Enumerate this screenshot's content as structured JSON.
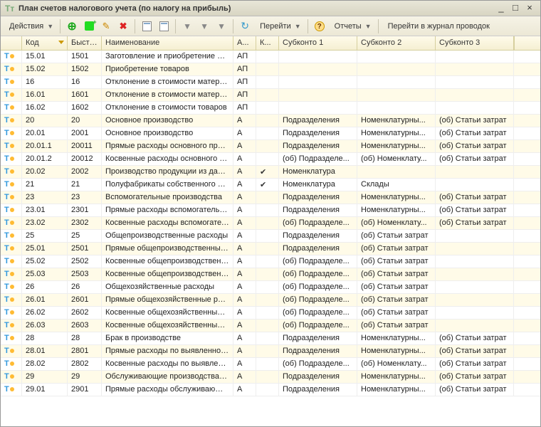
{
  "title": "План счетов налогового учета (по налогу на прибыль)",
  "toolbar": {
    "actions": "Действия",
    "go": "Перейти",
    "reports": "Отчеты",
    "journal": "Перейти в журнал проводок"
  },
  "columns": [
    "",
    "Код",
    "Быстр...",
    "Наименование",
    "А...",
    "К...",
    "Субконто 1",
    "Субконто 2",
    "Субконто 3"
  ],
  "rows": [
    {
      "code": "15.01",
      "fast": "1501",
      "name": "Заготовление и приобретение ма...",
      "ap": "АП",
      "k": "",
      "s1": "",
      "s2": "",
      "s3": ""
    },
    {
      "code": "15.02",
      "fast": "1502",
      "name": "Приобретение товаров",
      "ap": "АП",
      "k": "",
      "s1": "",
      "s2": "",
      "s3": ""
    },
    {
      "code": "16",
      "fast": "16",
      "name": "Отклонение в стоимости материа...",
      "ap": "АП",
      "k": "",
      "s1": "",
      "s2": "",
      "s3": ""
    },
    {
      "code": "16.01",
      "fast": "1601",
      "name": "Отклонение в стоимости материа...",
      "ap": "АП",
      "k": "",
      "s1": "",
      "s2": "",
      "s3": ""
    },
    {
      "code": "16.02",
      "fast": "1602",
      "name": "Отклонение в стоимости товаров",
      "ap": "АП",
      "k": "",
      "s1": "",
      "s2": "",
      "s3": ""
    },
    {
      "code": "20",
      "fast": "20",
      "name": "Основное производство",
      "ap": "А",
      "k": "",
      "s1": "Подразделения",
      "s2": "Номенклатурны...",
      "s3": "(об) Статьи затрат"
    },
    {
      "code": "20.01",
      "fast": "2001",
      "name": "Основное производство",
      "ap": "А",
      "k": "",
      "s1": "Подразделения",
      "s2": "Номенклатурны...",
      "s3": "(об) Статьи затрат"
    },
    {
      "code": "20.01.1",
      "fast": "20011",
      "name": "Прямые расходы основного прои...",
      "ap": "А",
      "k": "",
      "s1": "Подразделения",
      "s2": "Номенклатурны...",
      "s3": "(об) Статьи затрат"
    },
    {
      "code": "20.01.2",
      "fast": "20012",
      "name": "Косвенные расходы основного пр...",
      "ap": "А",
      "k": "",
      "s1": "(об) Подразделе...",
      "s2": "(об) Номенклату...",
      "s3": "(об) Статьи затрат"
    },
    {
      "code": "20.02",
      "fast": "2002",
      "name": "Производство продукции из дава...",
      "ap": "А",
      "k": "✔",
      "s1": "Номенклатура",
      "s2": "",
      "s3": ""
    },
    {
      "code": "21",
      "fast": "21",
      "name": "Полуфабрикаты собственного пр...",
      "ap": "А",
      "k": "✔",
      "s1": "Номенклатура",
      "s2": "Склады",
      "s3": ""
    },
    {
      "code": "23",
      "fast": "23",
      "name": "Вспомогательные производства",
      "ap": "А",
      "k": "",
      "s1": "Подразделения",
      "s2": "Номенклатурны...",
      "s3": "(об) Статьи затрат"
    },
    {
      "code": "23.01",
      "fast": "2301",
      "name": "Прямые расходы вспомогательн...",
      "ap": "А",
      "k": "",
      "s1": "Подразделения",
      "s2": "Номенклатурны...",
      "s3": "(об) Статьи затрат"
    },
    {
      "code": "23.02",
      "fast": "2302",
      "name": "Косвенные расходы вспомогател...",
      "ap": "А",
      "k": "",
      "s1": "(об) Подразделе...",
      "s2": "(об) Номенклату...",
      "s3": "(об) Статьи затрат"
    },
    {
      "code": "25",
      "fast": "25",
      "name": "Общепроизводственные расходы",
      "ap": "А",
      "k": "",
      "s1": "Подразделения",
      "s2": "(об) Статьи затрат",
      "s3": ""
    },
    {
      "code": "25.01",
      "fast": "2501",
      "name": "Прямые общепроизводственные ...",
      "ap": "А",
      "k": "",
      "s1": "Подразделения",
      "s2": "(об) Статьи затрат",
      "s3": ""
    },
    {
      "code": "25.02",
      "fast": "2502",
      "name": "Косвенные общепроизводственн...",
      "ap": "А",
      "k": "",
      "s1": "(об) Подразделе...",
      "s2": "(об) Статьи затрат",
      "s3": ""
    },
    {
      "code": "25.03",
      "fast": "2503",
      "name": "Косвенные общепроизводственн...",
      "ap": "А",
      "k": "",
      "s1": "(об) Подразделе...",
      "s2": "(об) Статьи затрат",
      "s3": ""
    },
    {
      "code": "26",
      "fast": "26",
      "name": "Общехозяйственные расходы",
      "ap": "А",
      "k": "",
      "s1": "(об) Подразделе...",
      "s2": "(об) Статьи затрат",
      "s3": ""
    },
    {
      "code": "26.01",
      "fast": "2601",
      "name": "Прямые общехозяйственные рас...",
      "ap": "А",
      "k": "",
      "s1": "(об) Подразделе...",
      "s2": "(об) Статьи затрат",
      "s3": ""
    },
    {
      "code": "26.02",
      "fast": "2602",
      "name": "Косвенные общехозяйственные р...",
      "ap": "А",
      "k": "",
      "s1": "(об) Подразделе...",
      "s2": "(об) Статьи затрат",
      "s3": ""
    },
    {
      "code": "26.03",
      "fast": "2603",
      "name": "Косвенные общехозяйственные р...",
      "ap": "А",
      "k": "",
      "s1": "(об) Подразделе...",
      "s2": "(об) Статьи затрат",
      "s3": ""
    },
    {
      "code": "28",
      "fast": "28",
      "name": "Брак в производстве",
      "ap": "А",
      "k": "",
      "s1": "Подразделения",
      "s2": "Номенклатурны...",
      "s3": "(об) Статьи затрат"
    },
    {
      "code": "28.01",
      "fast": "2801",
      "name": "Прямые расходы по выявленном...",
      "ap": "А",
      "k": "",
      "s1": "Подразделения",
      "s2": "Номенклатурны...",
      "s3": "(об) Статьи затрат"
    },
    {
      "code": "28.02",
      "fast": "2802",
      "name": "Косвенные расходы по выявленн...",
      "ap": "А",
      "k": "",
      "s1": "(об) Подразделе...",
      "s2": "(об) Номенклату...",
      "s3": "(об) Статьи затрат"
    },
    {
      "code": "29",
      "fast": "29",
      "name": "Обслуживающие производства и ...",
      "ap": "А",
      "k": "",
      "s1": "Подразделения",
      "s2": "Номенклатурны...",
      "s3": "(об) Статьи затрат"
    },
    {
      "code": "29.01",
      "fast": "2901",
      "name": "Прямые расходы обслуживающих...",
      "ap": "А",
      "k": "",
      "s1": "Подразделения",
      "s2": "Номенклатурны...",
      "s3": "(об) Статьи затрат"
    }
  ]
}
